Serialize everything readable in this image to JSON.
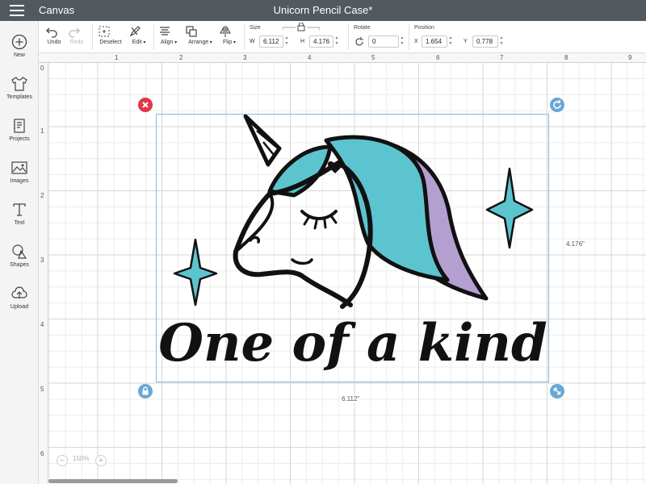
{
  "app": {
    "name": "Canvas",
    "document_title": "Unicorn Pencil Case*"
  },
  "sidebar": {
    "items": [
      {
        "label": "New",
        "icon": "plus-circle-icon"
      },
      {
        "label": "Templates",
        "icon": "shirt-icon"
      },
      {
        "label": "Projects",
        "icon": "projects-icon"
      },
      {
        "label": "Images",
        "icon": "image-icon"
      },
      {
        "label": "Text",
        "icon": "text-icon"
      },
      {
        "label": "Shapes",
        "icon": "shapes-icon"
      },
      {
        "label": "Upload",
        "icon": "upload-icon"
      }
    ]
  },
  "toolbar": {
    "undo": "Undo",
    "redo": "Redo",
    "deselect": "Deselect",
    "edit": "Edit",
    "align": "Align",
    "arrange": "Arrange",
    "flip": "Flip",
    "size_label": "Size",
    "w_label": "W",
    "w_value": "6.112",
    "h_label": "H",
    "h_value": "4.176",
    "rotate_label": "Rotate",
    "rotate_value": "0",
    "position_label": "Position",
    "x_label": "X",
    "x_value": "1.654",
    "y_label": "Y",
    "y_value": "0.778"
  },
  "ruler": {
    "top": [
      "1",
      "2",
      "3",
      "4",
      "5",
      "6",
      "7",
      "8",
      "9"
    ],
    "left": [
      "0",
      "1",
      "2",
      "3",
      "4",
      "5",
      "6"
    ]
  },
  "canvas": {
    "width_label": "6.112\"",
    "height_label": "4.176\"",
    "artwork_text": "One of a kind",
    "colors": {
      "teal": "#5cc4cf",
      "lavender": "#b49fd1",
      "outline": "#111111"
    }
  },
  "zoom": {
    "level": "150%"
  }
}
